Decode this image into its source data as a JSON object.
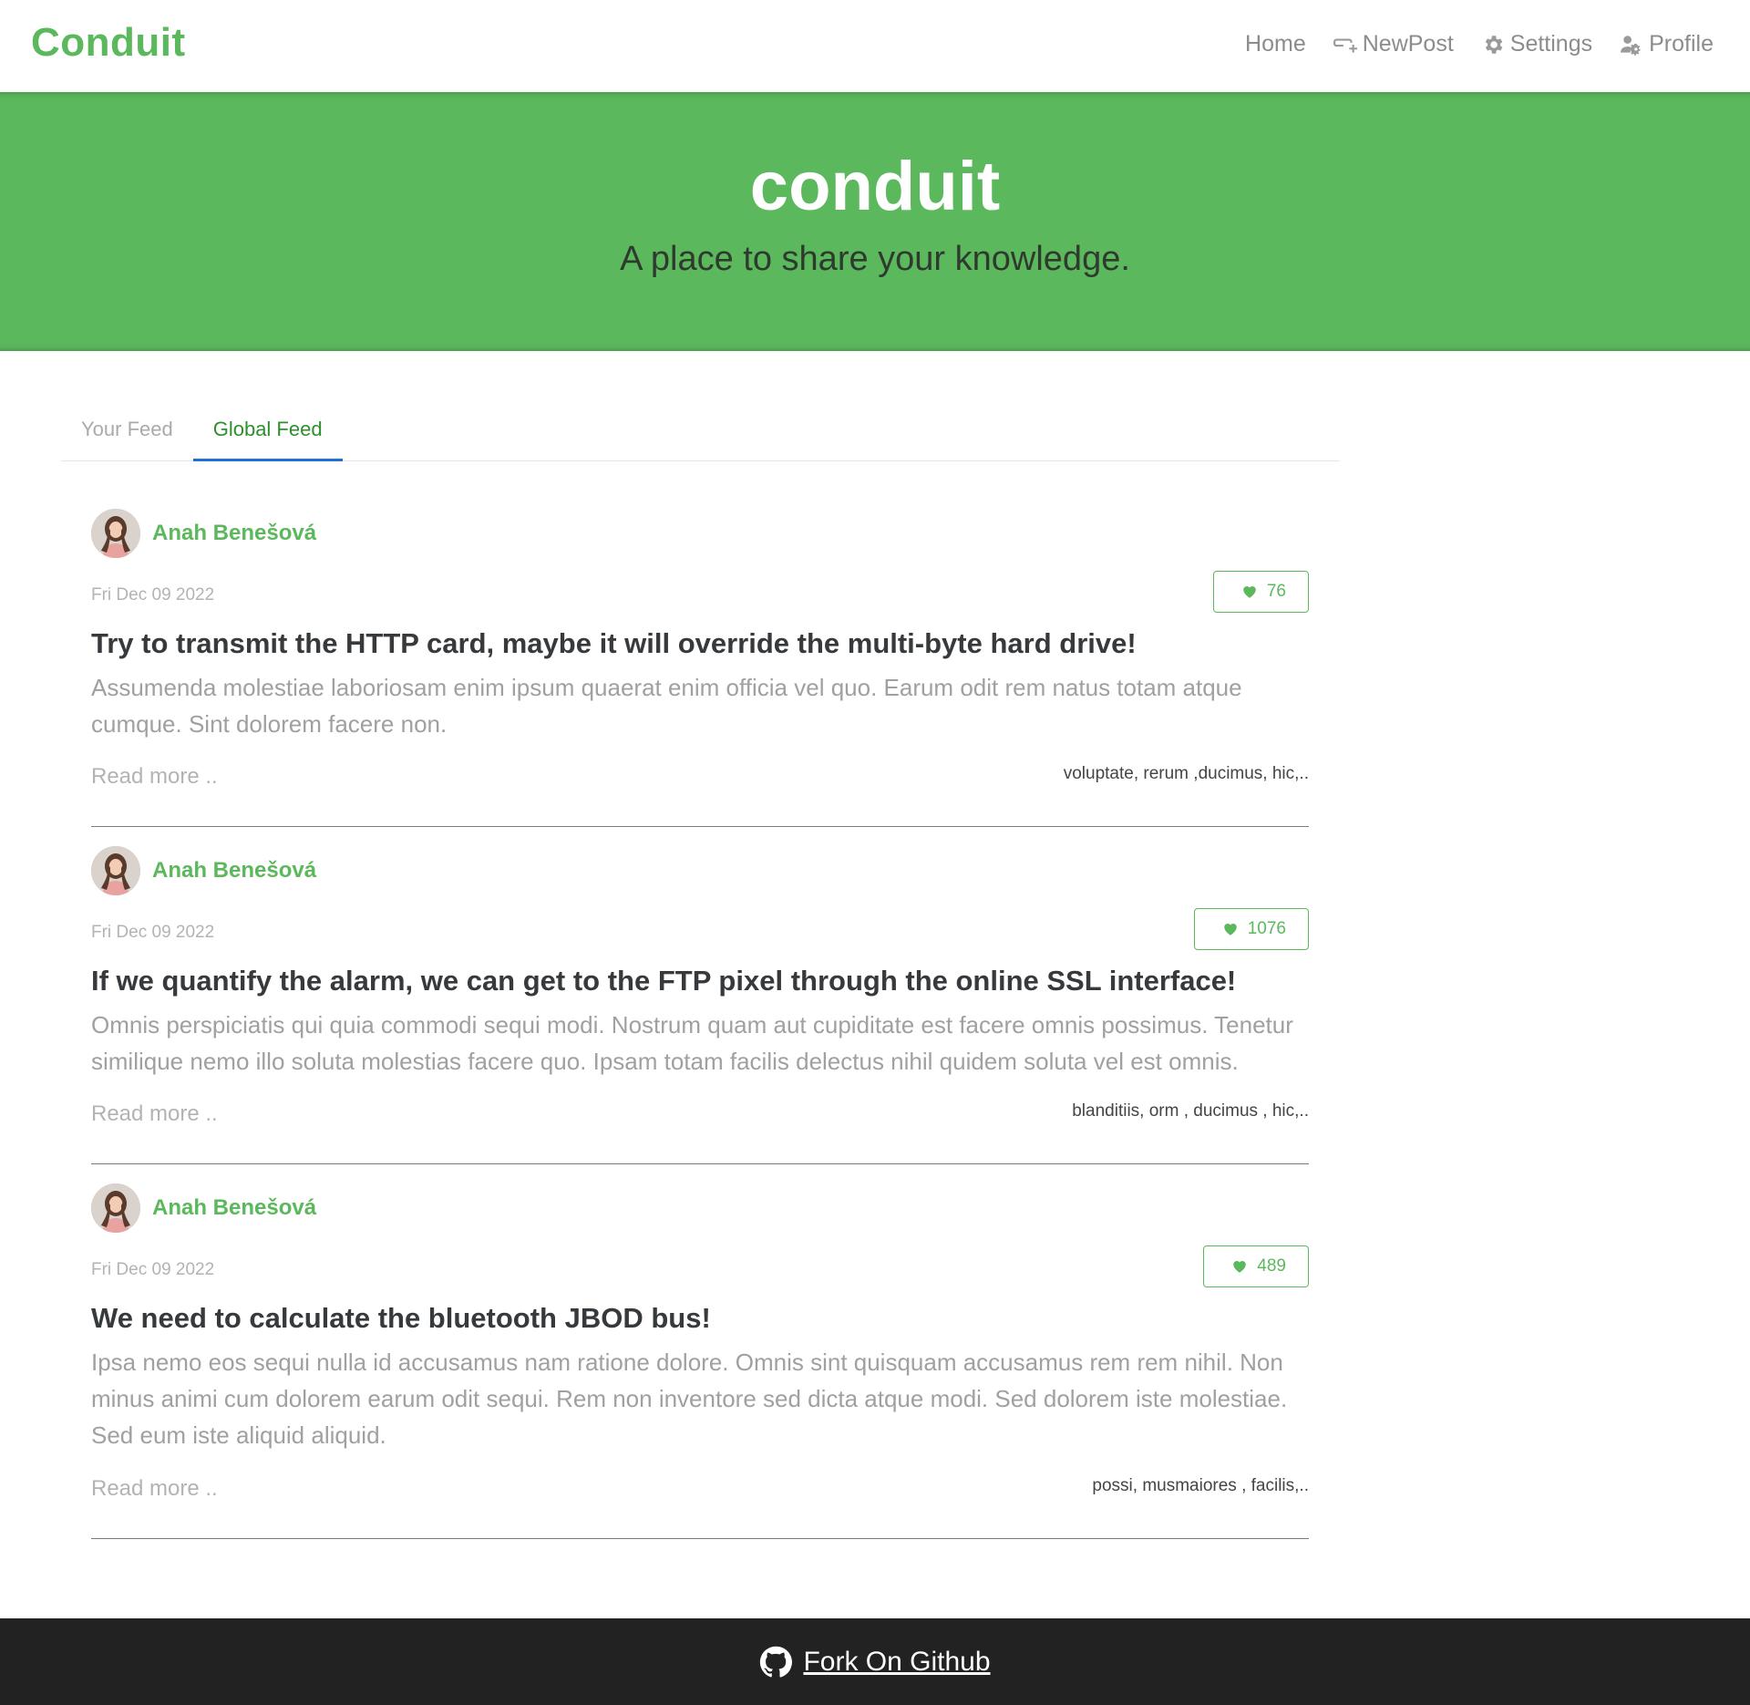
{
  "navbar": {
    "brand": "Conduit",
    "items": [
      {
        "label": "Home",
        "icon": "none"
      },
      {
        "label": "NewPost",
        "icon": "new-post-icon"
      },
      {
        "label": "Settings",
        "icon": "gear-icon"
      },
      {
        "label": "Profile",
        "icon": "user-gear-icon"
      }
    ]
  },
  "banner": {
    "title": "conduit",
    "subtitle": "A place to share your knowledge."
  },
  "tabs": [
    {
      "label": "Your Feed",
      "active": false
    },
    {
      "label": "Global Feed",
      "active": true
    }
  ],
  "articles": [
    {
      "author": "Anah Benešová",
      "date": "Fri Dec 09 2022",
      "likes": "76",
      "title": "Try to transmit the HTTP card, maybe it will override the multi-byte hard drive!",
      "description": "Assumenda molestiae laboriosam enim ipsum quaerat enim officia vel quo. Earum odit rem natus totam atque cumque. Sint dolorem facere non.",
      "read_more": "Read more ..",
      "tags": "voluptate, rerum ,ducimus, hic,.."
    },
    {
      "author": "Anah Benešová",
      "date": "Fri Dec 09 2022",
      "likes": "1076",
      "title": "If we quantify the alarm, we can get to the FTP pixel through the online SSL interface!",
      "description": "Omnis perspiciatis qui quia commodi sequi modi. Nostrum quam aut cupiditate est facere omnis possimus. Tenetur similique nemo illo soluta molestias facere quo. Ipsam totam facilis delectus nihil quidem soluta vel est omnis.",
      "read_more": "Read more ..",
      "tags": "blanditiis, orm , ducimus , hic,.."
    },
    {
      "author": "Anah Benešová",
      "date": "Fri Dec 09 2022",
      "likes": "489",
      "title": "We need to calculate the bluetooth JBOD bus!",
      "description": "Ipsa nemo eos sequi nulla id accusamus nam ratione dolore. Omnis sint quisquam accusamus rem rem nihil. Non minus animi cum dolorem earum odit sequi. Rem non inventore sed dicta atque modi. Sed dolorem iste molestiae. Sed eum iste aliquid aliquid.",
      "read_more": "Read more ..",
      "tags": "possi, musmaiores , facilis,.."
    }
  ],
  "footer": {
    "link_label": "Fork On Github",
    "icon": "github-icon"
  },
  "colors": {
    "brand_green": "#5cb85c",
    "active_tab_underline": "#1e6fd6",
    "footer_bg": "#222222"
  }
}
